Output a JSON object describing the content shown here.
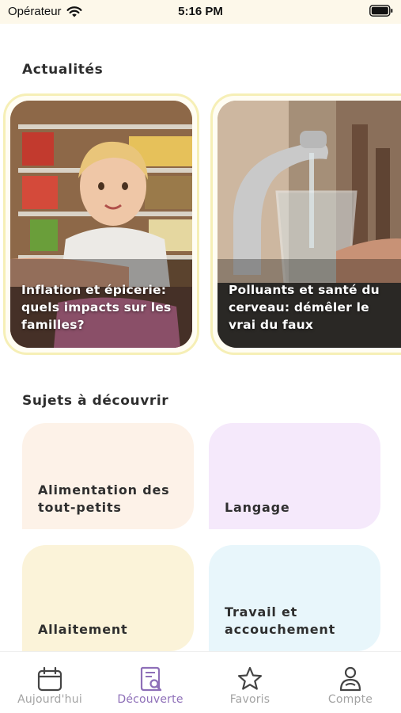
{
  "status_bar": {
    "carrier": "Opérateur",
    "time": "5:16 PM"
  },
  "news": {
    "title": "Actualités",
    "cards": [
      {
        "caption": "Inflation et épicerie: quels impacts sur les familles?"
      },
      {
        "caption": "Polluants et santé du cerveau: démêler le vrai du faux"
      }
    ]
  },
  "topics": {
    "title": "Sujets à découvrir",
    "items": [
      {
        "label": "Alimentation des tout-petits",
        "color": "#fdf2e8"
      },
      {
        "label": "Langage",
        "color": "#f5e9fb"
      },
      {
        "label": "Allaitement",
        "color": "#fbf3d9"
      },
      {
        "label": "Travail et accouchement",
        "color": "#e8f6fb"
      }
    ]
  },
  "tab_bar": {
    "tabs": [
      {
        "label": "Aujourd'hui",
        "icon": "calendar-icon",
        "active": false
      },
      {
        "label": "Découverte",
        "icon": "book-search-icon",
        "active": true
      },
      {
        "label": "Favoris",
        "icon": "star-icon",
        "active": false
      },
      {
        "label": "Compte",
        "icon": "person-icon",
        "active": false
      }
    ],
    "active_color": "#8e6fb8",
    "inactive_color": "#a3a3a3"
  }
}
